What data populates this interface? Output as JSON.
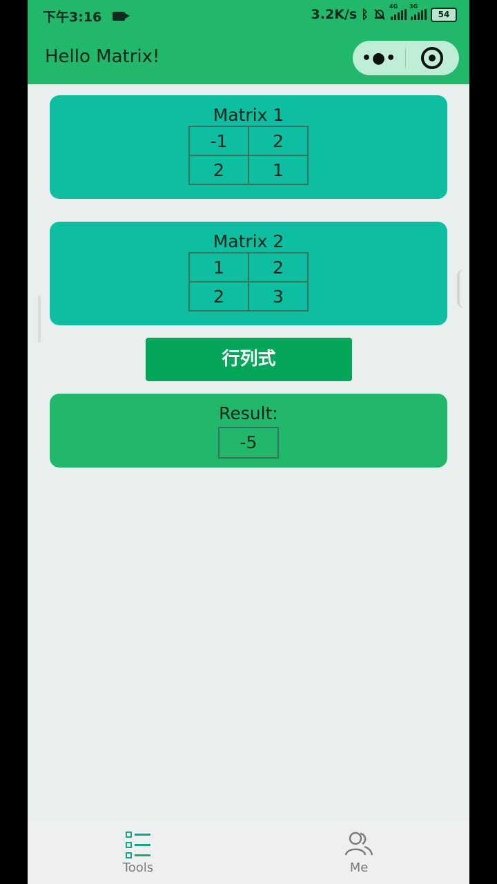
{
  "status_bar": {
    "time": "下午3:16",
    "speed": "3.2K/s",
    "net1": "4G",
    "net2": "3G",
    "battery": "54"
  },
  "nav": {
    "title": "Hello Matrix!",
    "menu_icon": "more-dots-icon",
    "close_icon": "target-circle-icon"
  },
  "matrix1": {
    "title": "Matrix 1",
    "rows": [
      [
        "-1",
        "2"
      ],
      [
        "2",
        "1"
      ]
    ]
  },
  "matrix2": {
    "title": "Matrix 2",
    "rows": [
      [
        "1",
        "2"
      ],
      [
        "2",
        "3"
      ]
    ]
  },
  "action_button": "行列式",
  "result": {
    "label": "Result:",
    "value": "-5"
  },
  "tabbar": {
    "tabs": [
      {
        "label": "Tools",
        "icon": "list-icon",
        "color": "#0ea985"
      },
      {
        "label": "Me",
        "icon": "people-icon",
        "color": "#7a7a7a"
      }
    ]
  },
  "colors": {
    "header_green": "#22b86c",
    "card_teal": "#0ebea0",
    "button_green": "#04a659",
    "background": "#e9efee"
  }
}
